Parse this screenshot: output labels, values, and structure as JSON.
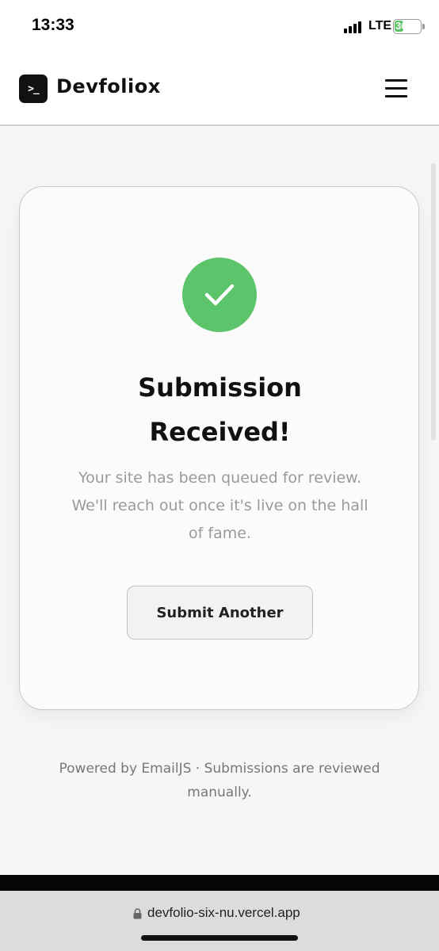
{
  "status_bar": {
    "time": "13:33",
    "network": "LTE",
    "battery": "36",
    "battery_level_percent": 36
  },
  "nav": {
    "logo_glyph": ">_",
    "brand": "Devfoliox",
    "menu_icon": "hamburger-menu-icon"
  },
  "card": {
    "icon": "checkmark-icon",
    "title": "Submission Received!",
    "message": "Your site has been queued for review. We'll reach out once it's live on the hall of fame.",
    "button_label": "Submit Another"
  },
  "footer": {
    "note": "Powered by EmailJS · Submissions are reviewed manually."
  },
  "browser": {
    "url": "devfolio-six-nu.vercel.app"
  },
  "colors": {
    "success": "#5cc46a",
    "text_primary": "#111111",
    "text_muted": "#9a9a9a"
  }
}
